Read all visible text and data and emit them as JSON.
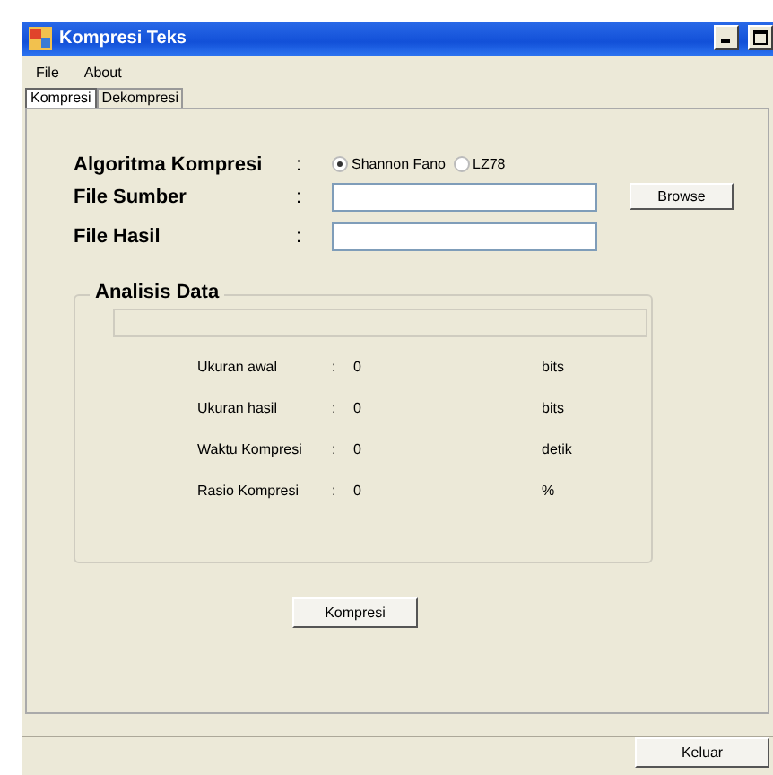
{
  "window": {
    "title": "Kompresi Teks"
  },
  "menu": [
    "File",
    "About"
  ],
  "tabs": [
    {
      "label": "Kompresi",
      "selected": true
    },
    {
      "label": "Dekompresi",
      "selected": false
    }
  ],
  "form": {
    "algorithm": {
      "label": "Algoritma Kompresi",
      "colon": ":",
      "options": [
        {
          "label": "Shannon Fano",
          "selected": true
        },
        {
          "label": "LZ78",
          "selected": false
        }
      ]
    },
    "source": {
      "label": "File Sumber",
      "colon": ":",
      "button": "Browse"
    },
    "result": {
      "label": "File Hasil",
      "colon": ":"
    }
  },
  "analysis": {
    "title": "Analisis Data",
    "progress": {
      "level": 0
    },
    "rows": [
      {
        "label": "Ukuran awal",
        "colon": ":",
        "value": "0",
        "unit": "bits"
      },
      {
        "label": "Ukuran hasil",
        "colon": ":",
        "value": "0",
        "unit": "bits"
      },
      {
        "label": "Waktu Kompresi",
        "colon": ":",
        "value": "0",
        "unit": "detik"
      },
      {
        "label": "Rasio Kompresi",
        "colon": ":",
        "value": "0",
        "unit": "%"
      }
    ]
  },
  "compress_button": "Kompresi",
  "exit_button": "Keluar"
}
